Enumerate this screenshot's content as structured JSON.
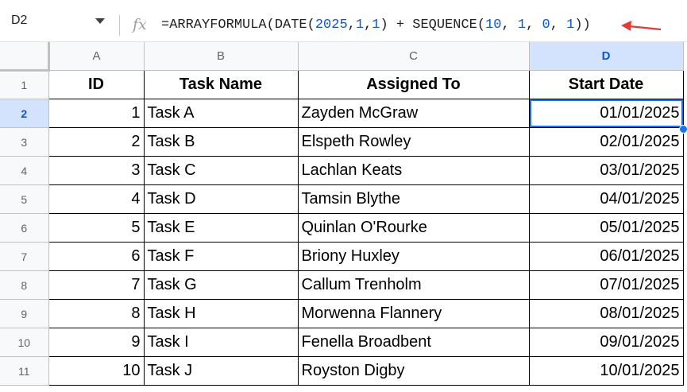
{
  "name_box": "D2",
  "formula": {
    "segments": [
      {
        "t": "=ARRAYFORMULA(DATE(",
        "n": false
      },
      {
        "t": "2025",
        "n": true
      },
      {
        "t": ",",
        "n": false
      },
      {
        "t": "1",
        "n": true
      },
      {
        "t": ",",
        "n": false
      },
      {
        "t": "1",
        "n": true
      },
      {
        "t": ") + SEQUENCE(",
        "n": false
      },
      {
        "t": "10",
        "n": true
      },
      {
        "t": ", ",
        "n": false
      },
      {
        "t": "1",
        "n": true
      },
      {
        "t": ", ",
        "n": false
      },
      {
        "t": "0",
        "n": true
      },
      {
        "t": ", ",
        "n": false
      },
      {
        "t": "1",
        "n": true
      },
      {
        "t": "))",
        "n": false
      }
    ]
  },
  "colors": {
    "accent": "#1a73e8",
    "formula_number": "#1155cc",
    "arrow": "#e53935"
  },
  "columns": [
    "A",
    "B",
    "C",
    "D"
  ],
  "headers": [
    "ID",
    "Task Name",
    "Assigned To",
    "Start Date"
  ],
  "rows": [
    [
      "1",
      "Task A",
      "Zayden McGraw",
      "01/01/2025"
    ],
    [
      "2",
      "Task B",
      "Elspeth Rowley",
      "02/01/2025"
    ],
    [
      "3",
      "Task C",
      "Lachlan Keats",
      "03/01/2025"
    ],
    [
      "4",
      "Task D",
      "Tamsin Blythe",
      "04/01/2025"
    ],
    [
      "5",
      "Task E",
      "Quinlan O'Rourke",
      "05/01/2025"
    ],
    [
      "6",
      "Task F",
      "Briony Huxley",
      "06/01/2025"
    ],
    [
      "7",
      "Task G",
      "Callum Trenholm",
      "07/01/2025"
    ],
    [
      "8",
      "Task H",
      "Morwenna Flannery",
      "08/01/2025"
    ],
    [
      "9",
      "Task I",
      "Fenella Broadbent",
      "09/01/2025"
    ],
    [
      "10",
      "Task J",
      "Royston Digby",
      "10/01/2025"
    ]
  ],
  "row_numbers": [
    "1",
    "2",
    "3",
    "4",
    "5",
    "6",
    "7",
    "8",
    "9",
    "10",
    "11"
  ]
}
